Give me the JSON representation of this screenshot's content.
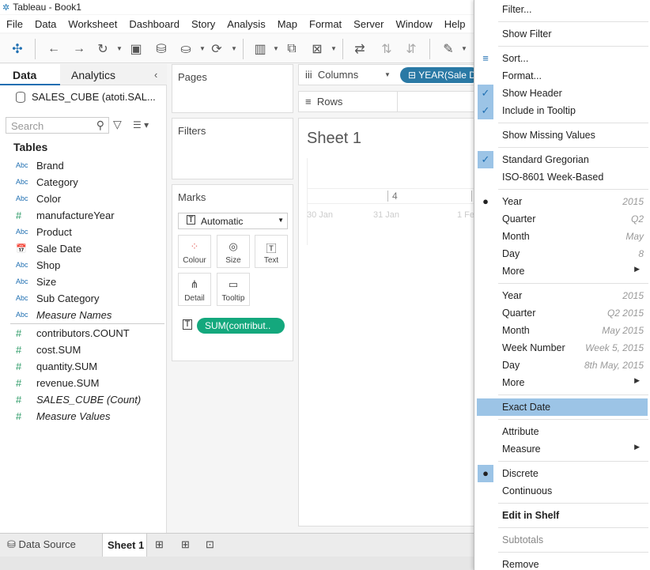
{
  "window": {
    "title": "Tableau - Book1"
  },
  "menu": [
    "File",
    "Data",
    "Worksheet",
    "Dashboard",
    "Story",
    "Analysis",
    "Map",
    "Format",
    "Server",
    "Window",
    "Help"
  ],
  "data_pane": {
    "tab_data": "Data",
    "tab_analytics": "Analytics",
    "datasource": "SALES_CUBE (atoti.SAL...",
    "search_placeholder": "Search",
    "tables_heading": "Tables",
    "dimensions": [
      {
        "type": "Abc",
        "name": "Brand"
      },
      {
        "type": "Abc",
        "name": "Category"
      },
      {
        "type": "Abc",
        "name": "Color"
      },
      {
        "type": "#",
        "name": "manufactureYear"
      },
      {
        "type": "Abc",
        "name": "Product"
      },
      {
        "type": "cal",
        "name": "Sale Date"
      },
      {
        "type": "Abc",
        "name": "Shop"
      },
      {
        "type": "Abc",
        "name": "Size"
      },
      {
        "type": "Abc",
        "name": "Sub Category"
      },
      {
        "type": "Abc",
        "name": "Measure Names"
      }
    ],
    "measures": [
      {
        "type": "#",
        "name": "contributors.COUNT"
      },
      {
        "type": "#",
        "name": "cost.SUM"
      },
      {
        "type": "#",
        "name": "quantity.SUM"
      },
      {
        "type": "#",
        "name": "revenue.SUM"
      },
      {
        "type": "#",
        "name": "SALES_CUBE (Count)"
      },
      {
        "type": "#",
        "name": "Measure Values"
      }
    ]
  },
  "cards": {
    "pages": "Pages",
    "filters": "Filters",
    "marks": "Marks",
    "mark_type": "Automatic",
    "mark_buttons": [
      "Colour",
      "Size",
      "Text",
      "Detail",
      "Tooltip"
    ],
    "mark_pill": "SUM(contribut.."
  },
  "shelves": {
    "columns": "Columns",
    "rows": "Rows",
    "columns_pill": "YEAR(Sale D"
  },
  "sheet": {
    "title": "Sheet 1",
    "header_value": "4",
    "axis_labels": [
      "30 Jan",
      "31 Jan",
      "1 Fe"
    ]
  },
  "bottom": {
    "datasource_tab": "Data Source",
    "sheet_tab": "Sheet 1"
  },
  "context_menu": {
    "items": [
      {
        "label": "Filter...",
        "value": ""
      },
      {
        "label": "Show Filter",
        "value": ""
      },
      {
        "label": "Sort...",
        "value": ""
      },
      {
        "label": "Format...",
        "value": ""
      },
      {
        "label": "Show Header",
        "value": ""
      },
      {
        "label": "Include in Tooltip",
        "value": ""
      },
      {
        "label": "Show Missing Values",
        "value": ""
      },
      {
        "label": "Standard Gregorian",
        "value": ""
      },
      {
        "label": "ISO-8601 Week-Based",
        "value": ""
      },
      {
        "label": "Year",
        "value": "2015"
      },
      {
        "label": "Quarter",
        "value": "Q2"
      },
      {
        "label": "Month",
        "value": "May"
      },
      {
        "label": "Day",
        "value": "8"
      },
      {
        "label": "More",
        "value": ""
      },
      {
        "label": "Year",
        "value": "2015"
      },
      {
        "label": "Quarter",
        "value": "Q2 2015"
      },
      {
        "label": "Month",
        "value": "May 2015"
      },
      {
        "label": "Week Number",
        "value": "Week 5, 2015"
      },
      {
        "label": "Day",
        "value": "8th May, 2015"
      },
      {
        "label": "More",
        "value": ""
      },
      {
        "label": "Exact Date",
        "value": ""
      },
      {
        "label": "Attribute",
        "value": ""
      },
      {
        "label": "Measure",
        "value": ""
      },
      {
        "label": "Discrete",
        "value": ""
      },
      {
        "label": "Continuous",
        "value": ""
      },
      {
        "label": "Edit in Shelf",
        "value": ""
      },
      {
        "label": "Subtotals",
        "value": ""
      },
      {
        "label": "Remove",
        "value": ""
      }
    ]
  },
  "colors": {
    "accent": "#1f6fb2",
    "pill_green": "#14a87d",
    "pill_blue": "#2a79a5",
    "highlight": "#9cc4e6"
  }
}
